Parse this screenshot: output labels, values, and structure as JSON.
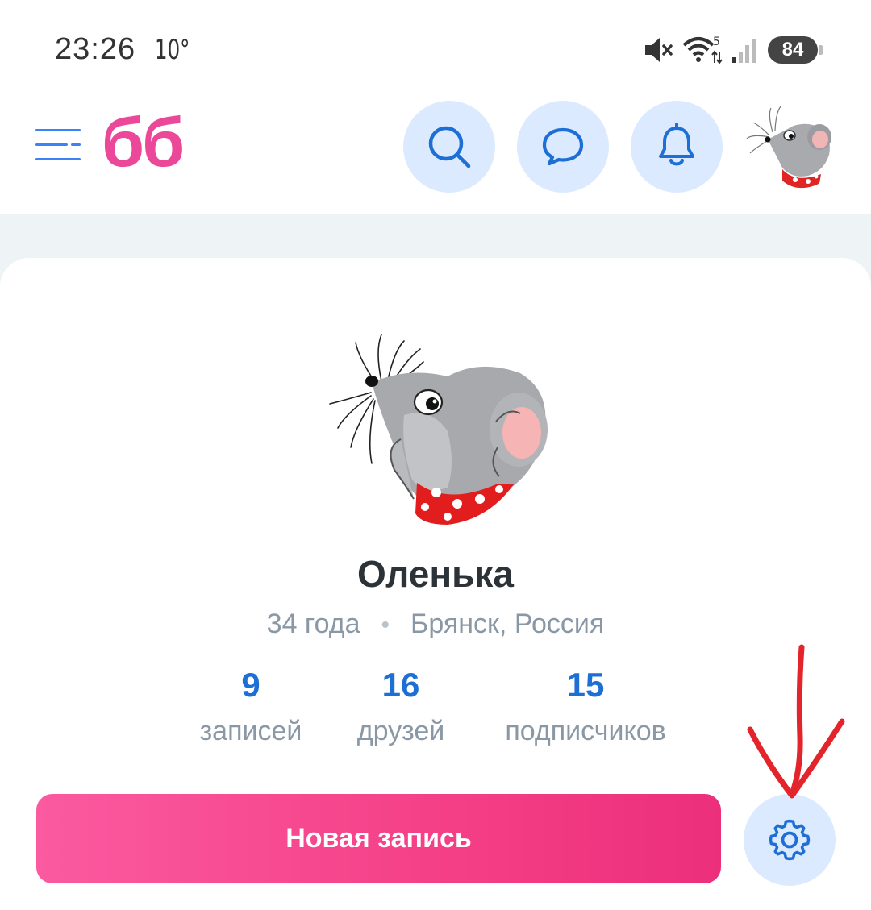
{
  "status_bar": {
    "time": "23:26",
    "temperature": "10°",
    "battery": "84",
    "icons": [
      "mute-icon",
      "wifi-icon",
      "signal-icon",
      "battery-icon"
    ]
  },
  "header": {
    "logo": "бб",
    "icons": [
      "menu-icon",
      "search-icon",
      "chat-icon",
      "bell-icon",
      "avatar"
    ],
    "accent_color": "#3b82f6",
    "logo_color": "#ec4899"
  },
  "profile": {
    "name": "Оленька",
    "age": "34 года",
    "location": "Брянск, Россия",
    "stats": [
      {
        "value": "9",
        "label": "записей"
      },
      {
        "value": "16",
        "label": "друзей"
      },
      {
        "value": "15",
        "label": "подписчиков"
      }
    ]
  },
  "actions": {
    "new_post_label": "Новая запись",
    "settings_icon": "gear-icon"
  },
  "colors": {
    "button_gradient": [
      "#fb5aa0",
      "#ec2f7b"
    ],
    "stat_number": "#1d6fd6",
    "icon_button_bg": "#dbeafe",
    "annotation_arrow": "#e3242b"
  }
}
